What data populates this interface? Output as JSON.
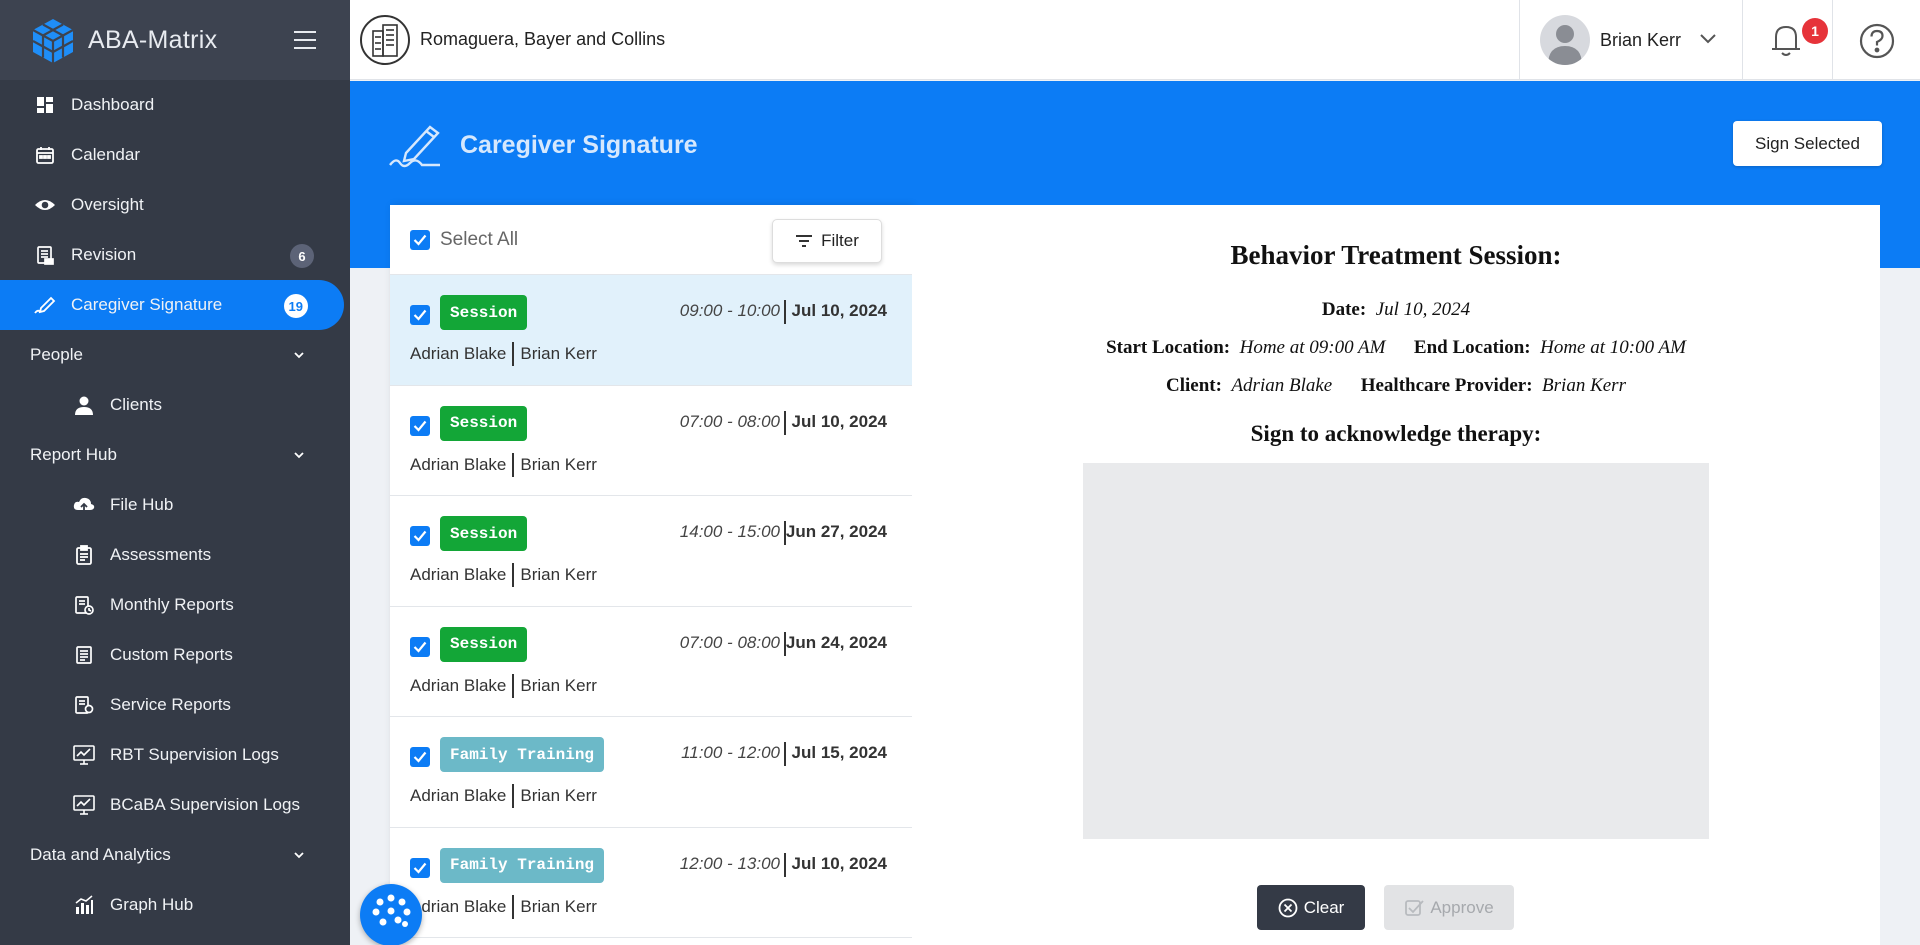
{
  "app": {
    "name": "ABA-Matrix"
  },
  "topbar": {
    "org_name": "Romaguera, Bayer and Collins",
    "user_name": "Brian Kerr",
    "notification_count": "1"
  },
  "sidebar": {
    "items": [
      {
        "label": "Dashboard",
        "icon": "dashboard-icon"
      },
      {
        "label": "Calendar",
        "icon": "calendar-icon"
      },
      {
        "label": "Oversight",
        "icon": "eye-icon"
      },
      {
        "label": "Revision",
        "icon": "revision-icon",
        "badge": "6"
      },
      {
        "label": "Caregiver Signature",
        "icon": "signature-icon",
        "badge": "19",
        "active": true
      },
      {
        "label": "People",
        "section": true
      },
      {
        "label": "Clients",
        "icon": "person-icon"
      },
      {
        "label": "Report Hub",
        "section": true
      },
      {
        "label": "File Hub",
        "icon": "cloud-icon"
      },
      {
        "label": "Assessments",
        "icon": "assessment-icon"
      },
      {
        "label": "Monthly Reports",
        "icon": "monthly-report-icon"
      },
      {
        "label": "Custom Reports",
        "icon": "custom-report-icon"
      },
      {
        "label": "Service Reports",
        "icon": "service-report-icon"
      },
      {
        "label": "RBT Supervision Logs",
        "icon": "chart-board-icon"
      },
      {
        "label": "BCaBA Supervision Logs",
        "icon": "chart-board-icon"
      },
      {
        "label": "Data and Analytics",
        "section": true
      },
      {
        "label": "Graph Hub",
        "icon": "bar-chart-icon"
      }
    ]
  },
  "header": {
    "title": "Caregiver Signature",
    "sign_selected_label": "Sign Selected"
  },
  "list": {
    "select_all_label": "Select All",
    "filter_label": "Filter",
    "rows": [
      {
        "tag": "Session",
        "type": "session",
        "time": "09:00 - 10:00",
        "date": "Jul 10, 2024",
        "client": "Adrian Blake",
        "provider": "Brian Kerr",
        "selected": true
      },
      {
        "tag": "Session",
        "type": "session",
        "time": "07:00 - 08:00",
        "date": "Jul 10, 2024",
        "client": "Adrian Blake",
        "provider": "Brian Kerr"
      },
      {
        "tag": "Session",
        "type": "session",
        "time": "14:00 - 15:00",
        "date": "Jun 27, 2024",
        "client": "Adrian Blake",
        "provider": "Brian Kerr"
      },
      {
        "tag": "Session",
        "type": "session",
        "time": "07:00 - 08:00",
        "date": "Jun 24, 2024",
        "client": "Adrian Blake",
        "provider": "Brian Kerr"
      },
      {
        "tag": "Family Training",
        "type": "family",
        "time": "11:00 - 12:00",
        "date": "Jul 15, 2024",
        "client": "Adrian Blake",
        "provider": "Brian Kerr"
      },
      {
        "tag": "Family Training",
        "type": "family",
        "time": "12:00 - 13:00",
        "date": "Jul 10, 2024",
        "client": "Adrian Blake",
        "provider": "Brian Kerr"
      }
    ]
  },
  "detail": {
    "title": "Behavior Treatment Session:",
    "date_label": "Date:",
    "date_value": "Jul 10, 2024",
    "start_location_label": "Start Location:",
    "start_location_value": "Home at 09:00 AM",
    "end_location_label": "End Location:",
    "end_location_value": "Home at 10:00 AM",
    "client_label": "Client:",
    "client_value": "Adrian Blake",
    "provider_label": "Healthcare Provider:",
    "provider_value": "Brian Kerr",
    "sign_prompt": "Sign to acknowledge therapy:",
    "clear_label": "Clear",
    "approve_label": "Approve"
  },
  "colors": {
    "accent": "#0c7cf5",
    "sidebar_bg": "#343a46",
    "session_tag": "#13a637",
    "family_tag": "#6cb9c8",
    "notification": "#e6333a"
  }
}
